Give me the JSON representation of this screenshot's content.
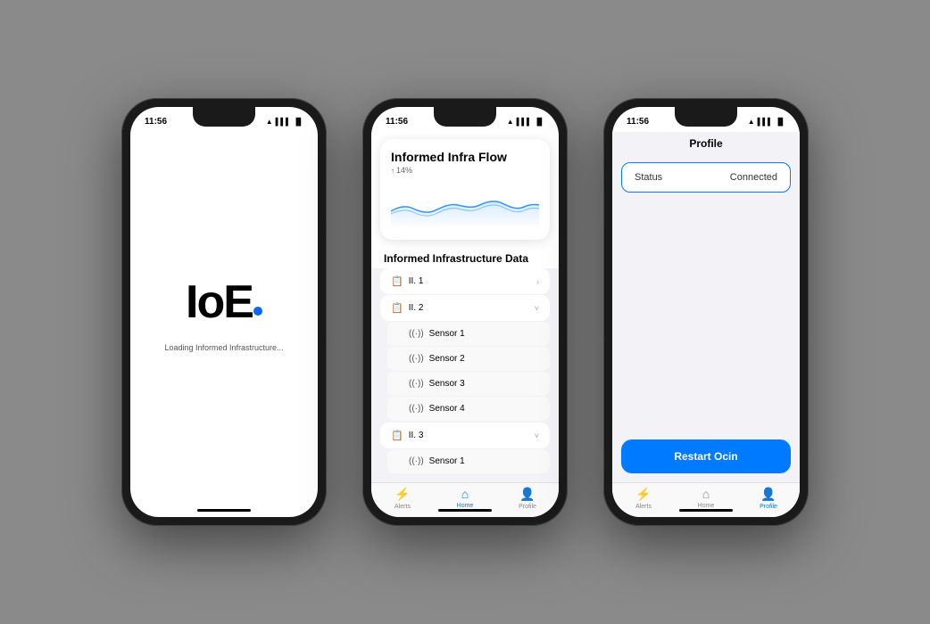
{
  "background": "#8a8a8a",
  "phones": {
    "splash": {
      "time": "11:56",
      "logo": "IoE.",
      "loading_text": "Loading Informed Infrastructure...",
      "dot_color": "#0066ff"
    },
    "home": {
      "time": "11:56",
      "chart": {
        "title": "Informed Infra Flow",
        "trend_arrow": "↑",
        "trend_value": "14%"
      },
      "section_label": "Informed Infrastructure Data",
      "items": [
        {
          "id": "II. 1",
          "type": "parent",
          "chevron": "›",
          "expanded": false
        },
        {
          "id": "II. 2",
          "type": "parent",
          "chevron": "˅",
          "expanded": true,
          "children": [
            "Sensor 1",
            "Sensor 2",
            "Sensor 3",
            "Sensor 4"
          ]
        },
        {
          "id": "II. 3",
          "type": "parent",
          "chevron": "˅",
          "expanded": true,
          "children": [
            "Sensor 1"
          ]
        }
      ],
      "tabs": [
        {
          "label": "Alerts",
          "icon": "⚡",
          "active": false
        },
        {
          "label": "Home",
          "icon": "⌂",
          "active": true
        },
        {
          "label": "Profile",
          "icon": "👤",
          "active": false
        }
      ]
    },
    "profile": {
      "time": "11:56",
      "title": "Profile",
      "status_label": "Status",
      "status_value": "Connected",
      "restart_button": "Restart Ocin",
      "tabs": [
        {
          "label": "Alerts",
          "icon": "⚡",
          "active": false
        },
        {
          "label": "Home",
          "icon": "⌂",
          "active": false
        },
        {
          "label": "Profile",
          "icon": "👤",
          "active": true
        }
      ]
    }
  }
}
